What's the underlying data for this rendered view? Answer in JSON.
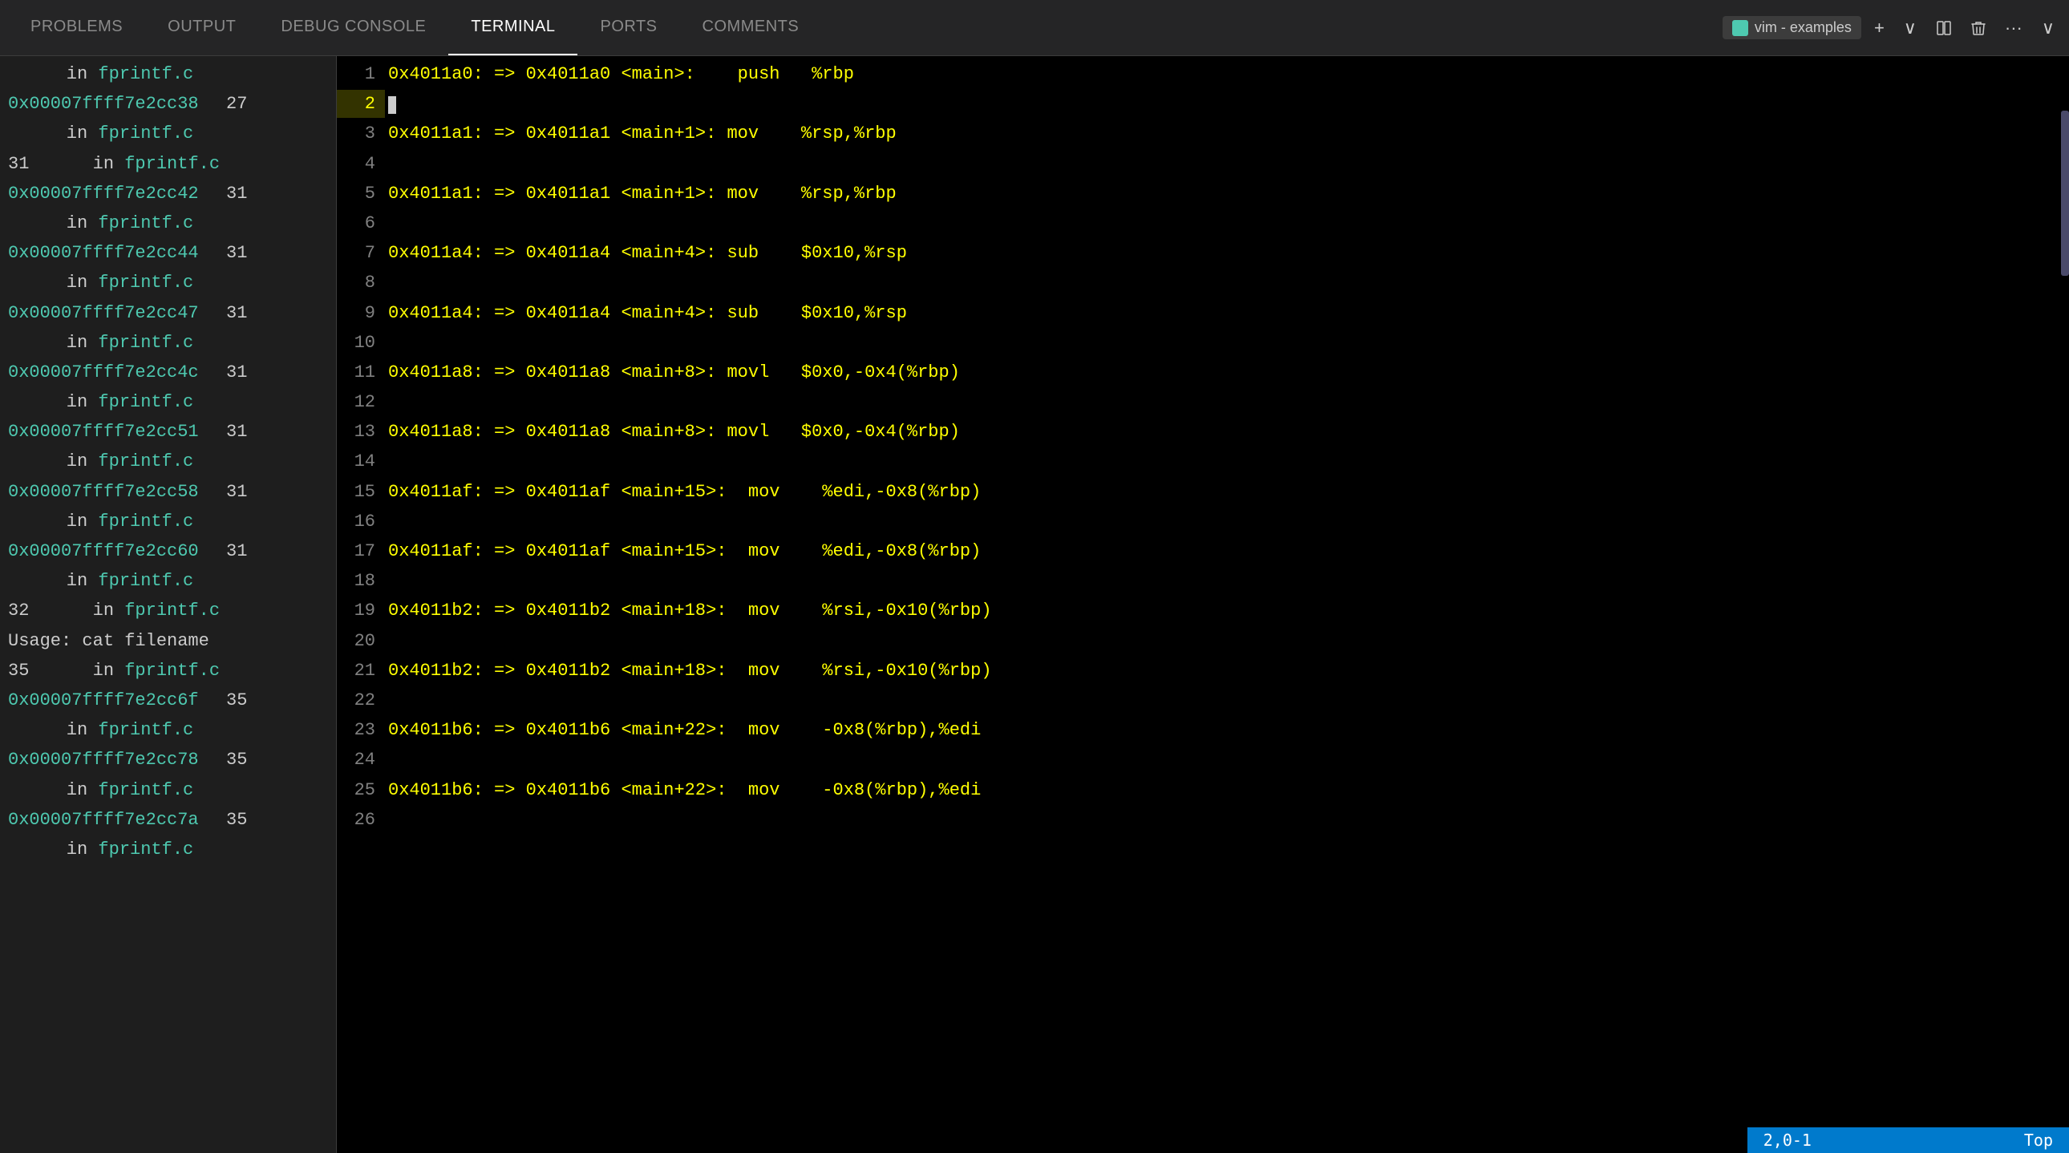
{
  "tabs": [
    {
      "id": "problems",
      "label": "PROBLEMS",
      "active": false
    },
    {
      "id": "output",
      "label": "OUTPUT",
      "active": false
    },
    {
      "id": "debug-console",
      "label": "DEBUG CONSOLE",
      "active": false
    },
    {
      "id": "terminal",
      "label": "TERMINAL",
      "active": true
    },
    {
      "id": "ports",
      "label": "PORTS",
      "active": false
    },
    {
      "id": "comments",
      "label": "COMMENTS",
      "active": false
    }
  ],
  "terminal_instance": "vim - examples",
  "icons": {
    "plus": "+",
    "chevron_down": "∨",
    "split": "⊡",
    "trash": "🗑",
    "more": "···",
    "chevron_right": "∨"
  },
  "left_panel": [
    {
      "type": "indent",
      "text": "in fprintf.c"
    },
    {
      "type": "addr_num",
      "addr": "0x00007ffff7e2cc38",
      "num": "27"
    },
    {
      "type": "indent",
      "text": "in fprintf.c"
    },
    {
      "type": "plain_indent",
      "text": "31      in fprintf.c"
    },
    {
      "type": "addr_num",
      "addr": "0x00007ffff7e2cc42",
      "num": "31"
    },
    {
      "type": "indent",
      "text": "in fprintf.c"
    },
    {
      "type": "addr_num",
      "addr": "0x00007ffff7e2cc44",
      "num": "31"
    },
    {
      "type": "indent",
      "text": "in fprintf.c"
    },
    {
      "type": "addr_num",
      "addr": "0x00007ffff7e2cc47",
      "num": "31"
    },
    {
      "type": "indent",
      "text": "in fprintf.c"
    },
    {
      "type": "addr_num",
      "addr": "0x00007ffff7e2cc4c",
      "num": "31"
    },
    {
      "type": "indent",
      "text": "in fprintf.c"
    },
    {
      "type": "addr_num",
      "addr": "0x00007ffff7e2cc51",
      "num": "31"
    },
    {
      "type": "indent",
      "text": "in fprintf.c"
    },
    {
      "type": "addr_num",
      "addr": "0x00007ffff7e2cc58",
      "num": "31"
    },
    {
      "type": "indent",
      "text": "in fprintf.c"
    },
    {
      "type": "addr_num",
      "addr": "0x00007ffff7e2cc60",
      "num": "31"
    },
    {
      "type": "indent",
      "text": "in fprintf.c"
    },
    {
      "type": "plain_num",
      "text": "32      in fprintf.c"
    },
    {
      "type": "plain",
      "text": "Usage: cat filename"
    },
    {
      "type": "plain_num2",
      "text": "35      in fprintf.c"
    },
    {
      "type": "addr_num",
      "addr": "0x00007ffff7e2cc6f",
      "num": "35"
    },
    {
      "type": "indent",
      "text": "in fprintf.c"
    },
    {
      "type": "addr_num",
      "addr": "0x00007ffff7e2cc78",
      "num": "35"
    },
    {
      "type": "indent",
      "text": "in fprintf.c"
    },
    {
      "type": "addr_num",
      "addr": "0x00007ffff7e2cc7a",
      "num": "35"
    },
    {
      "type": "indent",
      "text": "in fprintf.c"
    }
  ],
  "right_panel": [
    {
      "num": "1",
      "content": "0x4011a0: => 0x4011a0 <main>:    push   %rbp",
      "current": false
    },
    {
      "num": "2",
      "content": "",
      "current": true,
      "cursor": true
    },
    {
      "num": "3",
      "content": "0x4011a1: => 0x4011a1 <main+1>: mov    %rsp,%rbp",
      "current": false
    },
    {
      "num": "4",
      "content": "",
      "current": false
    },
    {
      "num": "5",
      "content": "0x4011a1: => 0x4011a1 <main+1>: mov    %rsp,%rbp",
      "current": false
    },
    {
      "num": "6",
      "content": "",
      "current": false
    },
    {
      "num": "7",
      "content": "0x4011a4: => 0x4011a4 <main+4>: sub    $0x10,%rsp",
      "current": false
    },
    {
      "num": "8",
      "content": "",
      "current": false
    },
    {
      "num": "9",
      "content": "0x4011a4: => 0x4011a4 <main+4>: sub    $0x10,%rsp",
      "current": false
    },
    {
      "num": "10",
      "content": "",
      "current": false
    },
    {
      "num": "11",
      "content": "0x4011a8: => 0x4011a8 <main+8>: movl   $0x0,-0x4(%rbp)",
      "current": false
    },
    {
      "num": "12",
      "content": "",
      "current": false
    },
    {
      "num": "13",
      "content": "0x4011a8: => 0x4011a8 <main+8>: movl   $0x0,-0x4(%rbp)",
      "current": false
    },
    {
      "num": "14",
      "content": "",
      "current": false
    },
    {
      "num": "15",
      "content": "0x4011af: => 0x4011af <main+15>:  mov    %edi,-0x8(%rbp)",
      "current": false
    },
    {
      "num": "16",
      "content": "",
      "current": false
    },
    {
      "num": "17",
      "content": "0x4011af: => 0x4011af <main+15>:  mov    %edi,-0x8(%rbp)",
      "current": false
    },
    {
      "num": "18",
      "content": "",
      "current": false
    },
    {
      "num": "19",
      "content": "0x4011b2: => 0x4011b2 <main+18>:  mov    %rsi,-0x10(%rbp)",
      "current": false
    },
    {
      "num": "20",
      "content": "",
      "current": false
    },
    {
      "num": "21",
      "content": "0x4011b2: => 0x4011b2 <main+18>:  mov    %rsi,-0x10(%rbp)",
      "current": false
    },
    {
      "num": "22",
      "content": "",
      "current": false
    },
    {
      "num": "23",
      "content": "0x4011b6: => 0x4011b6 <main+22>:  mov    -0x8(%rbp),%edi",
      "current": false
    },
    {
      "num": "24",
      "content": "",
      "current": false
    },
    {
      "num": "25",
      "content": "0x4011b6: => 0x4011b6 <main+22>:  mov    -0x8(%rbp),%edi",
      "current": false
    },
    {
      "num": "26",
      "content": "",
      "current": false
    }
  ],
  "status": {
    "position": "2,0-1",
    "location": "Top"
  }
}
